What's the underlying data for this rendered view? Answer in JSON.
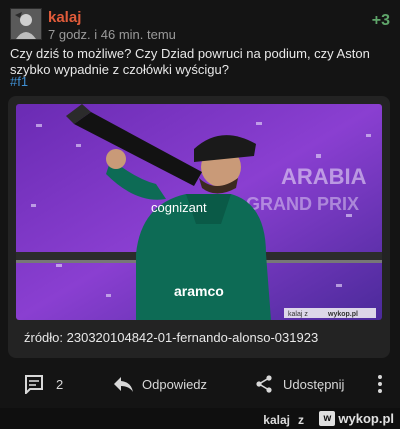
{
  "post": {
    "username": "kalaj",
    "time": "7 godz. i 46 min. temu",
    "score": "+3",
    "text": "Czy dziś to możliwe? Czy Dziad powruci na podium, czy Aston szybko wypadnie z czołówki wyścigu?",
    "tag": "#f1"
  },
  "embed": {
    "source": "źródło: 230320104842-01-fernando-alonso-031923",
    "watermark_user": "kalaj z",
    "watermark_site": "wykop.pl",
    "backdrop_text": "ARABIA",
    "backdrop_text2": "GRAND PRIX",
    "shirt_brand": "cognizant",
    "shirt_brand2": "aramco"
  },
  "actions": {
    "comments_count": "2",
    "reply": "Odpowiedz",
    "share": "Udostępnij"
  },
  "footer": {
    "user": "kalaj",
    "z": "z",
    "brand": "wykop.pl",
    "brand_icon": "w"
  },
  "colors": {
    "username": "#e05b3a",
    "score": "#5fa56a",
    "tag": "#3f8fd2"
  }
}
